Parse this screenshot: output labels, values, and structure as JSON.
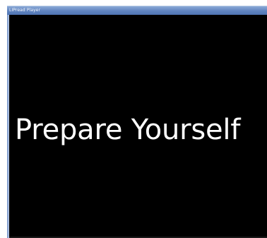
{
  "window": {
    "title": "LIPread Player"
  },
  "player": {
    "message": "Prepare Yourself",
    "background_color": "#000000",
    "text_color": "#ffffff"
  },
  "colors": {
    "titlebar": "#5f83bf"
  }
}
